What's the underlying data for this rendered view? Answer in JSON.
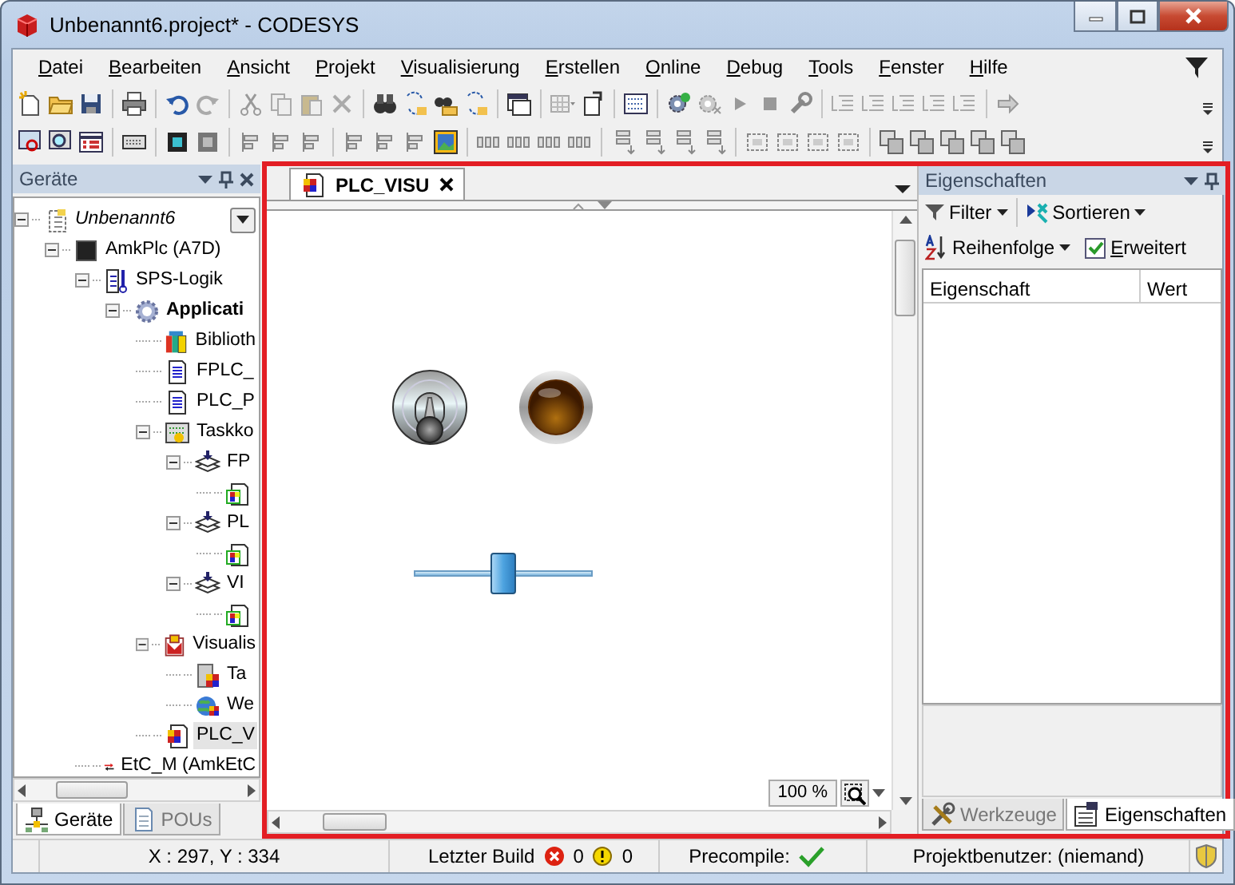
{
  "window": {
    "title": "Unbenannt6.project* - CODESYS"
  },
  "menu": [
    "Datei",
    "Bearbeiten",
    "Ansicht",
    "Projekt",
    "Visualisierung",
    "Erstellen",
    "Online",
    "Debug",
    "Tools",
    "Fenster",
    "Hilfe"
  ],
  "devices_panel": {
    "title": "Geräte",
    "tree": [
      {
        "label": "Unbenannt6",
        "kind": "project",
        "expanded": true,
        "selected": false,
        "children": [
          {
            "label": "AmkPlc (A7D)",
            "kind": "device",
            "expanded": true,
            "selected": false,
            "children": [
              {
                "label": "SPS-Logik",
                "kind": "plc-logic",
                "expanded": true,
                "selected": false,
                "children": [
                  {
                    "label": "Applicati",
                    "kind": "application",
                    "expanded": true,
                    "selected": false,
                    "children": [
                      {
                        "label": "Biblioth",
                        "kind": "library",
                        "selected": false
                      },
                      {
                        "label": "FPLC_",
                        "kind": "pou",
                        "selected": false
                      },
                      {
                        "label": "PLC_P",
                        "kind": "pou",
                        "selected": false
                      },
                      {
                        "label": "Taskko",
                        "kind": "task-config",
                        "expanded": true,
                        "selected": false,
                        "children": [
                          {
                            "label": "FP",
                            "kind": "task",
                            "expanded": true,
                            "selected": false,
                            "children": [
                              {
                                "kind": "visu-ref",
                                "selected": false
                              }
                            ]
                          },
                          {
                            "label": "PL",
                            "kind": "task",
                            "expanded": true,
                            "selected": false,
                            "children": [
                              {
                                "kind": "visu-ref",
                                "selected": false
                              }
                            ]
                          },
                          {
                            "label": "VI",
                            "kind": "task",
                            "expanded": true,
                            "selected": false,
                            "children": [
                              {
                                "kind": "visu-ref",
                                "selected": false
                              }
                            ]
                          }
                        ]
                      },
                      {
                        "label": "Visualis",
                        "kind": "visu-manager",
                        "expanded": true,
                        "selected": false,
                        "children": [
                          {
                            "label": "Ta",
                            "kind": "target-visu",
                            "selected": false
                          },
                          {
                            "label": "We",
                            "kind": "web-visu",
                            "selected": false
                          }
                        ]
                      },
                      {
                        "label": "PLC_V",
                        "kind": "visu",
                        "selected": true
                      }
                    ]
                  }
                ]
              },
              {
                "label": "EtC_M (AmkEtC",
                "kind": "ethercat",
                "selected": false
              }
            ]
          }
        ]
      }
    ],
    "tabs": [
      {
        "label": "Geräte",
        "selected": true
      },
      {
        "label": "POUs",
        "selected": false
      }
    ]
  },
  "editor": {
    "tabs": [
      {
        "label": "PLC_VISU",
        "selected": true
      }
    ],
    "zoom": "100 %",
    "slider": {
      "level": 0.5
    }
  },
  "properties_panel": {
    "title": "Eigenschaften",
    "filter": "Filter",
    "sort": "Sortieren",
    "order": "Reihenfolge",
    "extended": {
      "label": "Erweitert",
      "checked": true
    },
    "columns": [
      "Eigenschaft",
      "Wert"
    ],
    "tabs": [
      {
        "label": "Werkzeuge",
        "selected": false
      },
      {
        "label": "Eigenschaften",
        "selected": true
      }
    ]
  },
  "status_bar": {
    "coords": "X : 297, Y : 334",
    "build_label": "Letzter Build",
    "errors": "0",
    "warnings": "0",
    "precompile": "Precompile:",
    "precompile_ok": true,
    "user": "Projektbenutzer: (niemand)"
  }
}
